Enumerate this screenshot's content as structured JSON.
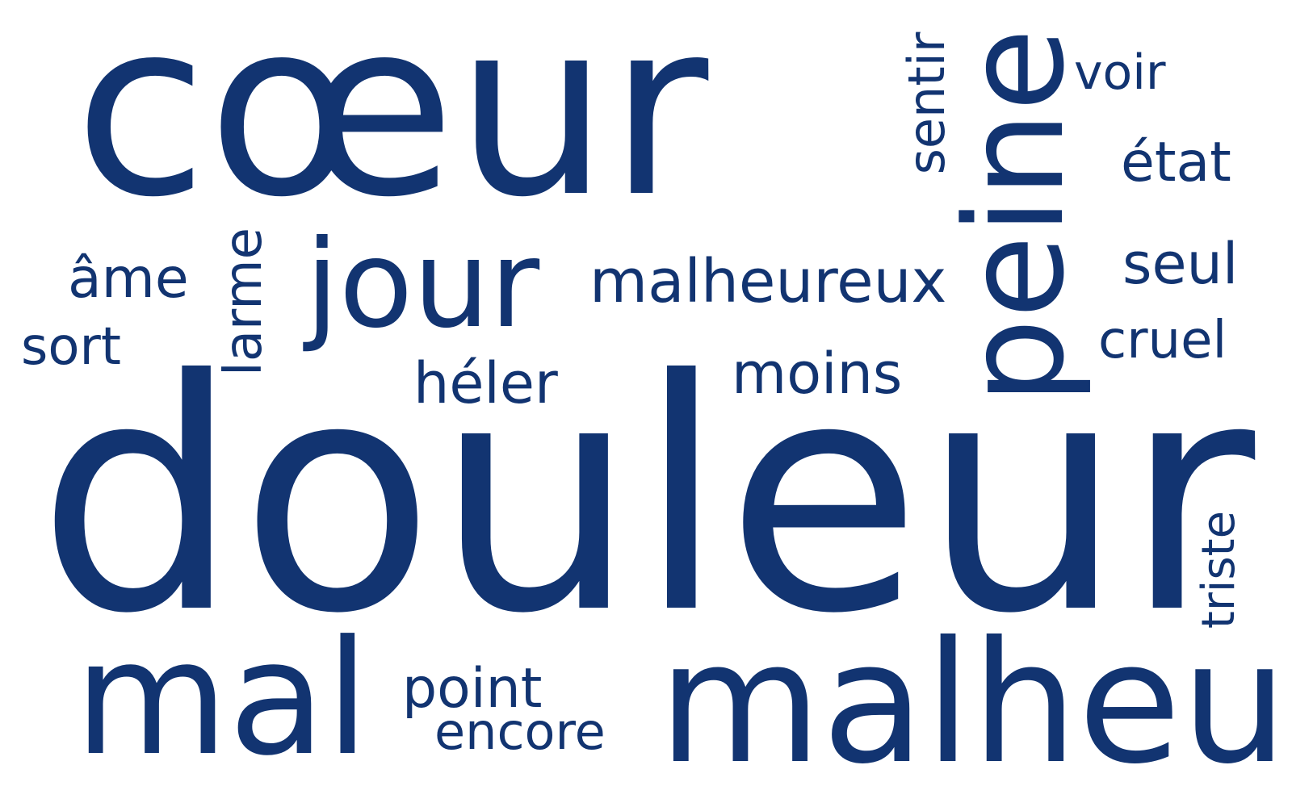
{
  "cloud": {
    "color": "#123471",
    "words": {
      "coeur": "cœur",
      "douleur": "douleur",
      "malheur": "malheur",
      "mal": "mal",
      "peine": "peine",
      "jour": "jour",
      "malheureux": "malheureux",
      "sentir": "sentir",
      "voir": "voir",
      "etat": "état",
      "seul": "seul",
      "cruel": "cruel",
      "ame": "âme",
      "sort": "sort",
      "larme": "larme",
      "heler": "héler",
      "moins": "moins",
      "triste": "triste",
      "point": "point",
      "encore": "encore"
    }
  }
}
